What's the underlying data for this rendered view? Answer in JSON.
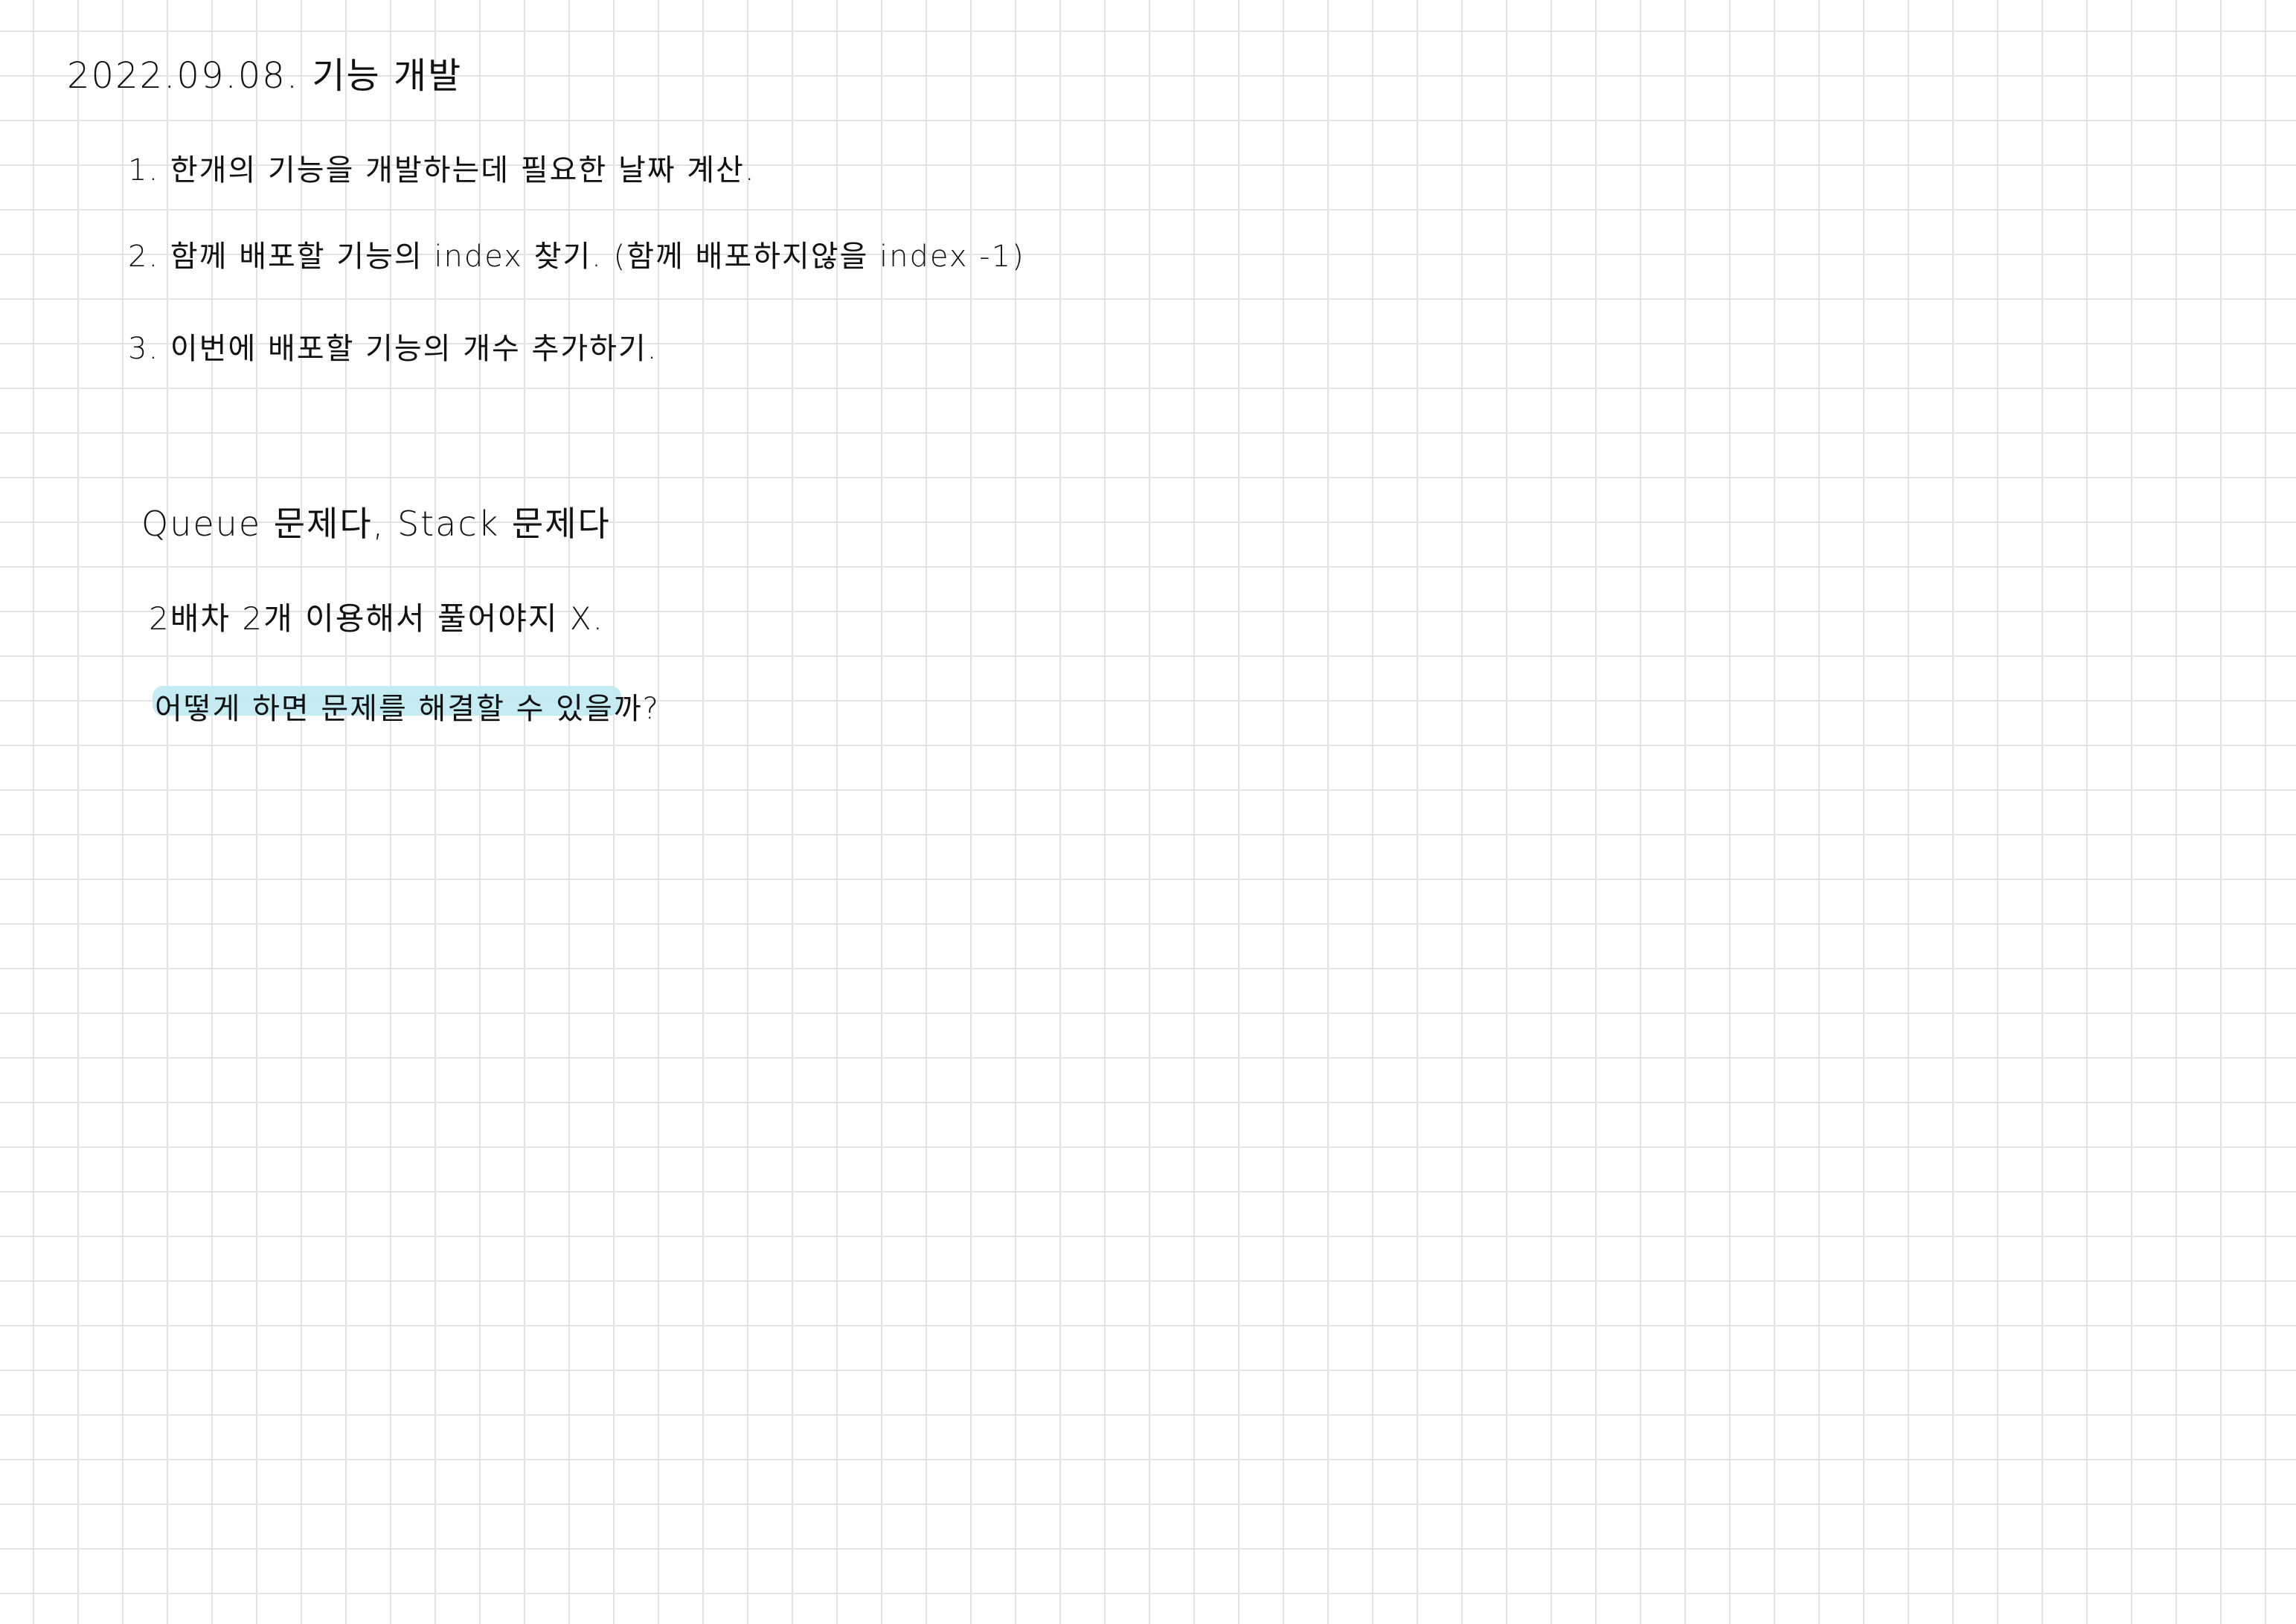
{
  "title": "2022.09.08. 기능 개발",
  "steps": [
    "1. 한개의 기능을 개발하는데 필요한 날짜 계산.",
    "2. 함께 배포할 기능의 index 찾기. (함께 배포하지않을 index -1)",
    "3. 이번에 배포할 기능의 개수 추가하기."
  ],
  "notes": [
    "Queue 문제다, Stack 문제다",
    "2배차 2개 이용해서 풀어야지 X.",
    "어떻게 하면 문제를 해결할 수 있을까?"
  ],
  "colors": {
    "ink": "#111111",
    "grid": "#dfe3e8",
    "highlight": "#bfeaf2"
  }
}
